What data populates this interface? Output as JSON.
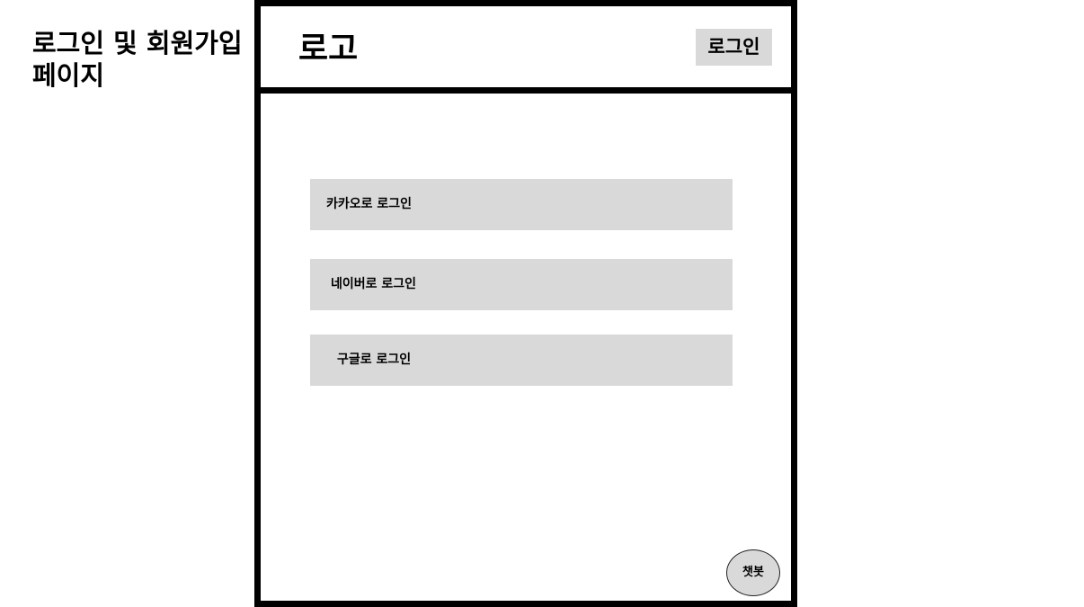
{
  "page": {
    "title": "로그인 및 회원가입 페이지"
  },
  "header": {
    "logo": "로고",
    "login_label": "로그인"
  },
  "main": {
    "social_logins": [
      {
        "label": "카카오로 로그인"
      },
      {
        "label": "네이버로 로그인"
      },
      {
        "label": "구글로 로그인"
      }
    ]
  },
  "chatbot": {
    "label": "챗봇"
  },
  "colors": {
    "button_bg": "#d9d9d9",
    "frame_border": "#000000",
    "background": "#ffffff"
  }
}
